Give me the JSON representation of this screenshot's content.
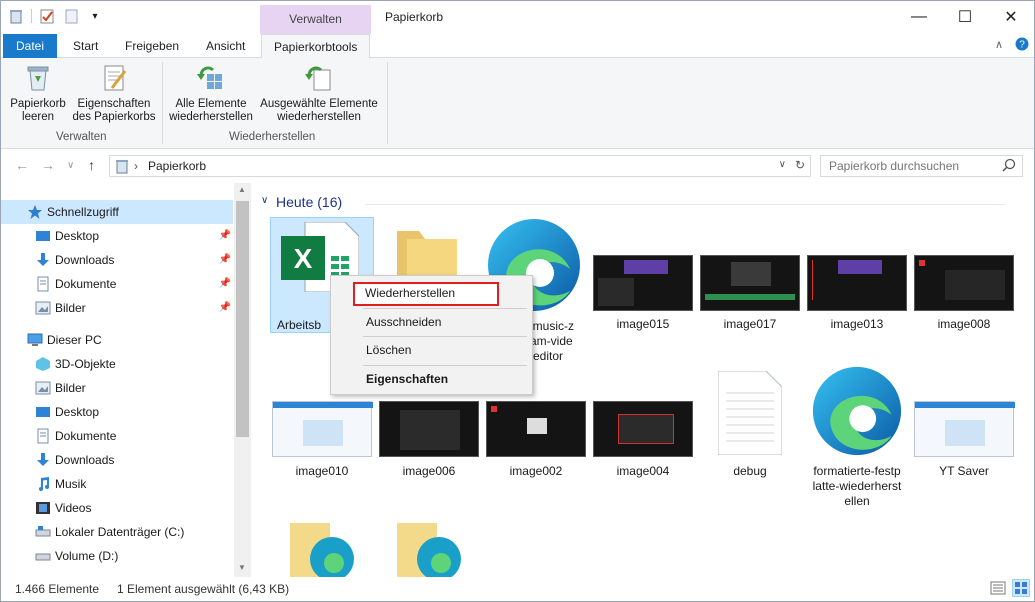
{
  "window": {
    "title": "Papierkorb",
    "context_tab_header": "Verwalten",
    "minimize": "—",
    "maximize": "☐",
    "close": "✕"
  },
  "ribbon": {
    "tabs": [
      "Datei",
      "Start",
      "Freigeben",
      "Ansicht",
      "Papierkorbtools"
    ],
    "active_tab": "Papierkorbtools",
    "groups": [
      {
        "label": "Verwalten",
        "buttons": [
          {
            "line1": "Papierkorb",
            "line2": "leeren",
            "icon": "recycle-bin-icon"
          },
          {
            "line1": "Eigenschaften",
            "line2": "des Papierkorbs",
            "icon": "properties-icon"
          }
        ]
      },
      {
        "label": "Wiederherstellen",
        "buttons": [
          {
            "line1": "Alle Elemente",
            "line2": "wiederherstellen",
            "icon": "restore-all-icon"
          },
          {
            "line1": "Ausgewählte Elemente",
            "line2": "wiederherstellen",
            "icon": "restore-selected-icon"
          }
        ]
      }
    ]
  },
  "address": {
    "breadcrumb": "Papierkorb",
    "search_placeholder": "Papierkorb durchsuchen"
  },
  "nav": {
    "quick_access": "Schnellzugriff",
    "quick_items": [
      {
        "label": "Desktop",
        "icon": "desktop-icon"
      },
      {
        "label": "Downloads",
        "icon": "downloads-icon"
      },
      {
        "label": "Dokumente",
        "icon": "documents-icon"
      },
      {
        "label": "Bilder",
        "icon": "pictures-icon"
      }
    ],
    "this_pc": "Dieser PC",
    "pc_items": [
      {
        "label": "3D-Objekte",
        "icon": "3d-objects-icon"
      },
      {
        "label": "Bilder",
        "icon": "pictures-icon"
      },
      {
        "label": "Desktop",
        "icon": "desktop-icon"
      },
      {
        "label": "Dokumente",
        "icon": "documents-icon"
      },
      {
        "label": "Downloads",
        "icon": "downloads-icon"
      },
      {
        "label": "Musik",
        "icon": "music-icon"
      },
      {
        "label": "Videos",
        "icon": "videos-icon"
      },
      {
        "label": "Lokaler Datenträger (C:)",
        "icon": "drive-c-icon"
      },
      {
        "label": "Volume (D:)",
        "icon": "drive-d-icon"
      }
    ]
  },
  "content": {
    "group_header": "Heute (16)",
    "row1": [
      {
        "caption": "Arbeitsb",
        "icon": "excel-file-icon",
        "selected": true
      },
      {
        "caption": "",
        "icon": "folder-icon"
      },
      {
        "caption": "e-music-z\neam-vide\neditor",
        "icon": "edge-icon"
      },
      {
        "caption": "image015",
        "icon": "screenshot-thumb"
      },
      {
        "caption": "image017",
        "icon": "screenshot-thumb"
      },
      {
        "caption": "image013",
        "icon": "screenshot-thumb"
      },
      {
        "caption": "image008",
        "icon": "screenshot-thumb"
      }
    ],
    "row2": [
      {
        "caption": "image010",
        "icon": "screenshot-thumb"
      },
      {
        "caption": "image006",
        "icon": "screenshot-thumb"
      },
      {
        "caption": "image002",
        "icon": "screenshot-thumb"
      },
      {
        "caption": "image004",
        "icon": "screenshot-thumb"
      },
      {
        "caption": "debug",
        "icon": "text-file-icon"
      },
      {
        "caption": "formatierte-festp\nlatte-wiederherst\nellen",
        "icon": "edge-icon"
      },
      {
        "caption": "YT Saver",
        "icon": "screenshot-thumb"
      }
    ]
  },
  "context_menu": {
    "items": [
      "Wiederherstellen",
      "Ausschneiden",
      "Löschen",
      "Eigenschaften"
    ],
    "highlight_color": "#e02020"
  },
  "status": {
    "count": "1.466 Elemente",
    "selection": "1 Element ausgewählt (6,43 KB)"
  },
  "colors": {
    "file_tab": "#1979ca",
    "context_tab": "#e6d4f2",
    "selection": "#cce8ff",
    "group_header": "#1e3287"
  }
}
